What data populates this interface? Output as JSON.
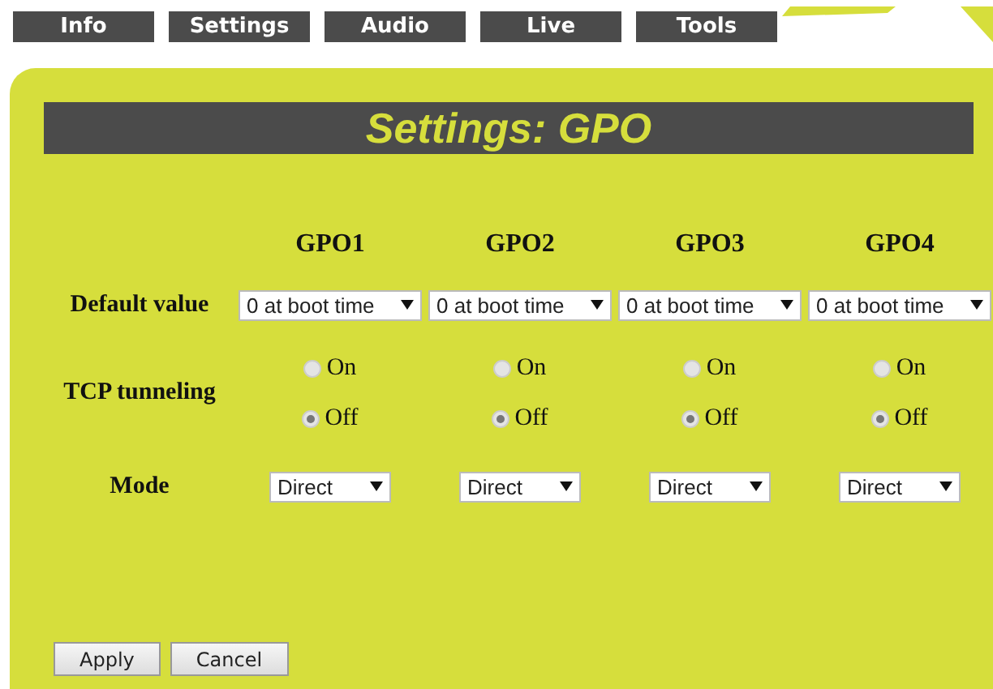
{
  "tabs": [
    {
      "label": "Info"
    },
    {
      "label": "Settings"
    },
    {
      "label": "Audio"
    },
    {
      "label": "Live"
    },
    {
      "label": "Tools"
    }
  ],
  "title": "Settings: GPO",
  "columns": [
    "GPO1",
    "GPO2",
    "GPO3",
    "GPO4"
  ],
  "rows": {
    "default_value": {
      "label": "Default value",
      "values": [
        "0 at boot time",
        "0 at boot time",
        "0 at boot time",
        "0 at boot time"
      ]
    },
    "tcp_tunneling": {
      "label": "TCP tunneling",
      "options": [
        {
          "on_label": "On",
          "off_label": "Off",
          "on": false
        },
        {
          "on_label": "On",
          "off_label": "Off",
          "on": false
        },
        {
          "on_label": "On",
          "off_label": "Off",
          "on": false
        },
        {
          "on_label": "On",
          "off_label": "Off",
          "on": false
        }
      ]
    },
    "mode": {
      "label": "Mode",
      "values": [
        "Direct",
        "Direct",
        "Direct",
        "Direct"
      ]
    }
  },
  "buttons": [
    "Apply",
    "Cancel"
  ]
}
